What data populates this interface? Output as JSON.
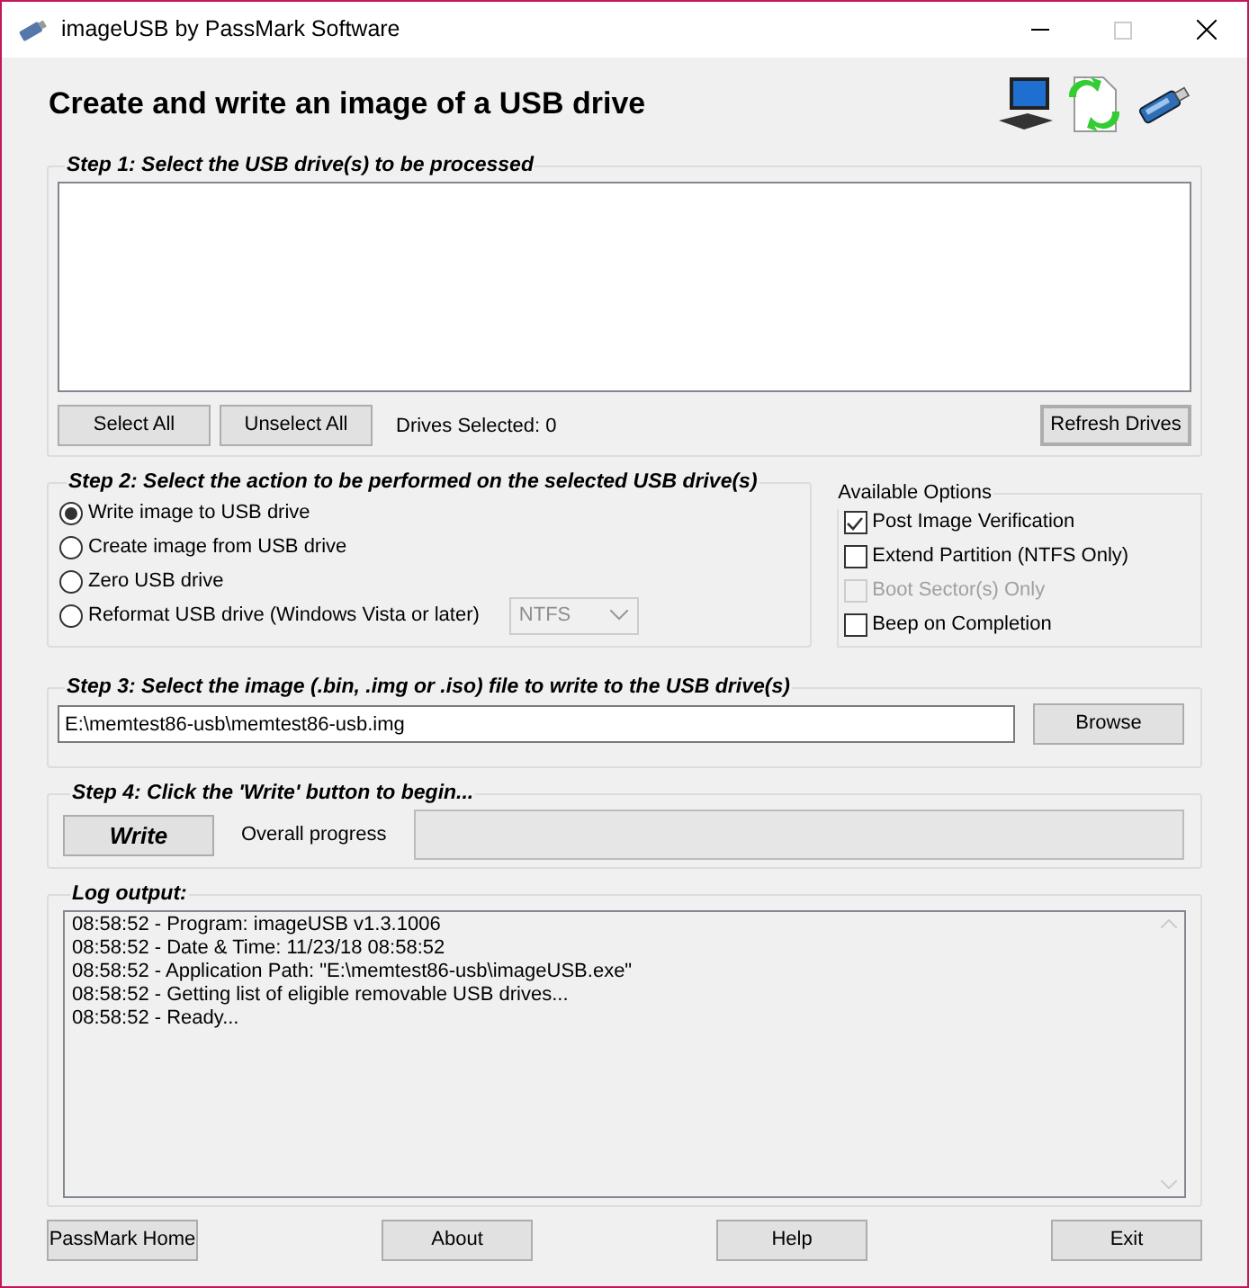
{
  "window": {
    "title": "imageUSB by PassMark Software"
  },
  "header": {
    "title": "Create and write an image of a USB drive"
  },
  "step1": {
    "legend": "Step 1:  Select the USB drive(s) to be processed",
    "buttons": [
      "Select All",
      "Unselect All"
    ],
    "drives_selected": "Drives Selected: 0",
    "refresh": "Refresh Drives"
  },
  "step2": {
    "legend": "Step 2: Select the action to be performed on the selected USB drive(s)",
    "actions": [
      {
        "label": "Write image to USB drive",
        "selected": true
      },
      {
        "label": "Create image from USB drive",
        "selected": false
      },
      {
        "label": "Zero USB drive",
        "selected": false
      },
      {
        "label": "Reformat USB drive (Windows Vista or later)",
        "selected": false
      }
    ],
    "format_dropdown": {
      "value": "NTFS",
      "disabled": true
    }
  },
  "options": {
    "legend": "Available Options",
    "items": [
      {
        "label": "Post Image Verification",
        "checked": true,
        "disabled": false
      },
      {
        "label": "Extend Partition (NTFS Only)",
        "checked": false,
        "disabled": false
      },
      {
        "label": "Boot Sector(s) Only",
        "checked": false,
        "disabled": true
      },
      {
        "label": "Beep on Completion",
        "checked": false,
        "disabled": false
      }
    ]
  },
  "step3": {
    "legend": "Step 3: Select the image (.bin, .img or .iso) file to write to the USB drive(s)",
    "path": "E:\\memtest86-usb\\memtest86-usb.img",
    "browse": "Browse"
  },
  "step4": {
    "legend": "Step 4: Click the 'Write' button to begin...",
    "write": "Write",
    "progress_label": "Overall progress",
    "progress": {
      "level": 0
    }
  },
  "log": {
    "legend": "Log output:",
    "lines": [
      "08:58:52 - Program: imageUSB v1.3.1006",
      "08:58:52 - Date & Time: 11/23/18 08:58:52",
      "08:58:52 - Application Path: \"E:\\memtest86-usb\\imageUSB.exe\"",
      "08:58:52 - Getting list of eligible removable USB drives...",
      "08:58:52 - Ready..."
    ]
  },
  "footer": {
    "buttons": [
      "PassMark Home",
      "About",
      "Help",
      "Exit"
    ]
  }
}
